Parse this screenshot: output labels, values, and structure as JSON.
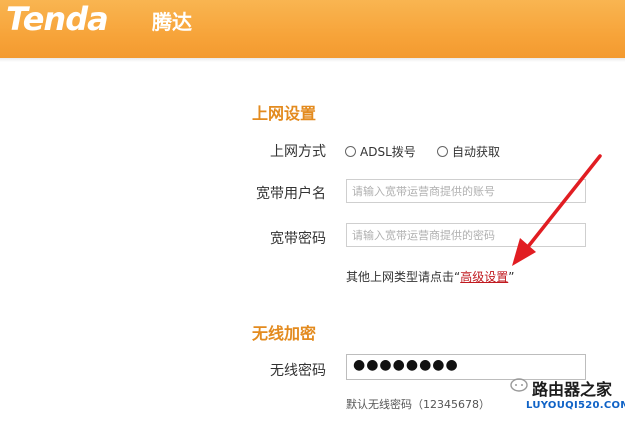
{
  "header": {
    "brand": "Tenda",
    "brand_cn": "腾达"
  },
  "internet": {
    "title": "上网设置",
    "mode_label": "上网方式",
    "options": [
      "ADSL拨号",
      "自动获取"
    ],
    "user_label": "宽带用户名",
    "user_placeholder": "请输入宽带运营商提供的账号",
    "pass_label": "宽带密码",
    "pass_placeholder": "请输入宽带运营商提供的密码",
    "hint_prefix": "其他上网类型请点击“",
    "hint_link": "高级设置",
    "hint_suffix": "”"
  },
  "wireless": {
    "title": "无线加密",
    "pass_label": "无线密码",
    "pass_value": "●●●●●●●●",
    "default_hint": "默认无线密码（12345678）"
  },
  "watermark": {
    "title": "路由器之家",
    "url": "LUYOUQI520.COM"
  },
  "colors": {
    "header_orange": "#f7a43a",
    "section_title": "#e38b1f",
    "link_red": "#c0191f",
    "arrow_red": "#e11d22"
  }
}
